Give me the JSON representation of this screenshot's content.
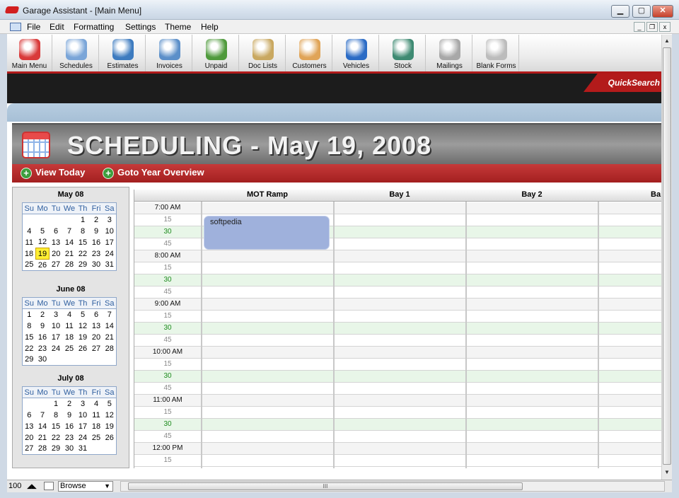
{
  "window": {
    "title": "Garage Assistant - [Main Menu]"
  },
  "menu": [
    "File",
    "Edit",
    "Formatting",
    "Settings",
    "Theme",
    "Help"
  ],
  "toolbar": [
    {
      "label": "Main Menu",
      "icon": "house-icon",
      "color": "#d93a3a"
    },
    {
      "label": "Schedules",
      "icon": "calendar-icon",
      "color": "#7aa5d8"
    },
    {
      "label": "Estimates",
      "icon": "clock-icon",
      "color": "#3d7bbf"
    },
    {
      "label": "Invoices",
      "icon": "calculator-icon",
      "color": "#5b8fc9"
    },
    {
      "label": "Unpaid",
      "icon": "money-bag-icon",
      "color": "#4f9a3c"
    },
    {
      "label": "Doc Lists",
      "icon": "document-list-icon",
      "color": "#c9a860"
    },
    {
      "label": "Customers",
      "icon": "people-icon",
      "color": "#e0a457"
    },
    {
      "label": "Vehicles",
      "icon": "car-icon",
      "color": "#2a6bc5"
    },
    {
      "label": "Stock",
      "icon": "cart-icon",
      "color": "#3e8a72"
    },
    {
      "label": "Mailings",
      "icon": "mail-document-icon",
      "color": "#a8a8a8"
    },
    {
      "label": "Blank Forms",
      "icon": "blank-form-icon",
      "color": "#bcbcbc"
    }
  ],
  "quicksearch": "QuickSearch",
  "scheduling": {
    "title": "SCHEDULING - May 19, 2008",
    "view_today": "View Today",
    "goto_year": "Goto Year Overview"
  },
  "calendar": {
    "dow": [
      "Su",
      "Mo",
      "Tu",
      "We",
      "Th",
      "Fri",
      "Sa"
    ],
    "months": [
      {
        "name": "May 08",
        "today": 19,
        "weeks": [
          [
            "",
            "",
            "",
            "",
            "1",
            "2",
            "3"
          ],
          [
            "4",
            "5",
            "6",
            "7",
            "8",
            "9",
            "10"
          ],
          [
            "11",
            "12",
            "13",
            "14",
            "15",
            "16",
            "17"
          ],
          [
            "18",
            "19",
            "20",
            "21",
            "22",
            "23",
            "24"
          ],
          [
            "25",
            "26",
            "27",
            "28",
            "29",
            "30",
            "31"
          ]
        ]
      },
      {
        "name": "June 08",
        "today": null,
        "weeks": [
          [
            "1",
            "2",
            "3",
            "4",
            "5",
            "6",
            "7"
          ],
          [
            "8",
            "9",
            "10",
            "11",
            "12",
            "13",
            "14"
          ],
          [
            "15",
            "16",
            "17",
            "18",
            "19",
            "20",
            "21"
          ],
          [
            "22",
            "23",
            "24",
            "25",
            "26",
            "27",
            "28"
          ],
          [
            "29",
            "30",
            "",
            "",
            "",
            "",
            ""
          ]
        ]
      },
      {
        "name": "July 08",
        "today": null,
        "weeks": [
          [
            "",
            "",
            "1",
            "2",
            "3",
            "4",
            "5"
          ],
          [
            "6",
            "7",
            "8",
            "9",
            "10",
            "11",
            "12"
          ],
          [
            "13",
            "14",
            "15",
            "16",
            "17",
            "18",
            "19"
          ],
          [
            "20",
            "21",
            "22",
            "23",
            "24",
            "25",
            "26"
          ],
          [
            "27",
            "28",
            "29",
            "30",
            "31",
            "",
            ""
          ]
        ]
      }
    ]
  },
  "grid": {
    "columns": [
      "MOT Ramp",
      "Bay 1",
      "Bay 2",
      "Ba"
    ],
    "times": [
      "7:00 AM",
      "15",
      "30",
      "45",
      "8:00 AM",
      "15",
      "30",
      "45",
      "9:00 AM",
      "15",
      "30",
      "45",
      "10:00 AM",
      "15",
      "30",
      "45",
      "11:00 AM",
      "15",
      "30",
      "45",
      "12:00 PM",
      "15"
    ],
    "appointment": {
      "text": "softpedia",
      "color": "#9fb1dc"
    }
  },
  "statusbar": {
    "zoom": "100",
    "mode": "Browse"
  }
}
